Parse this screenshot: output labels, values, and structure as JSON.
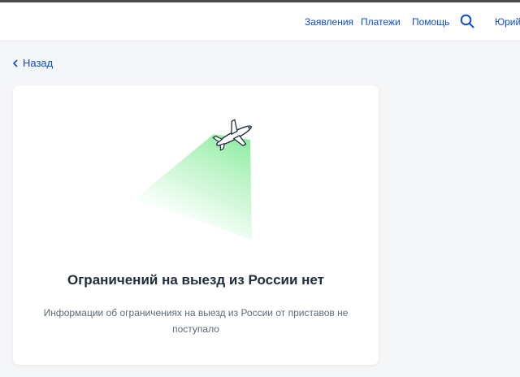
{
  "header": {
    "nav": {
      "applications": "Заявления",
      "payments": "Платежи",
      "help": "Помощь",
      "user": "Юрий"
    },
    "search_icon": "search-icon"
  },
  "back": {
    "label": "Назад",
    "icon": "chevron-left-icon"
  },
  "result": {
    "illustration": "airplane-icon",
    "title": "Ограничений на выезд из России нет",
    "message": "Информации об ограничениях на выезд из России от приставов не поступало"
  },
  "colors": {
    "link": "#0d4cd3",
    "title": "#1f2d3d",
    "text": "#5d6a78",
    "beam": "#33dd55",
    "background": "#f5f6f8"
  }
}
